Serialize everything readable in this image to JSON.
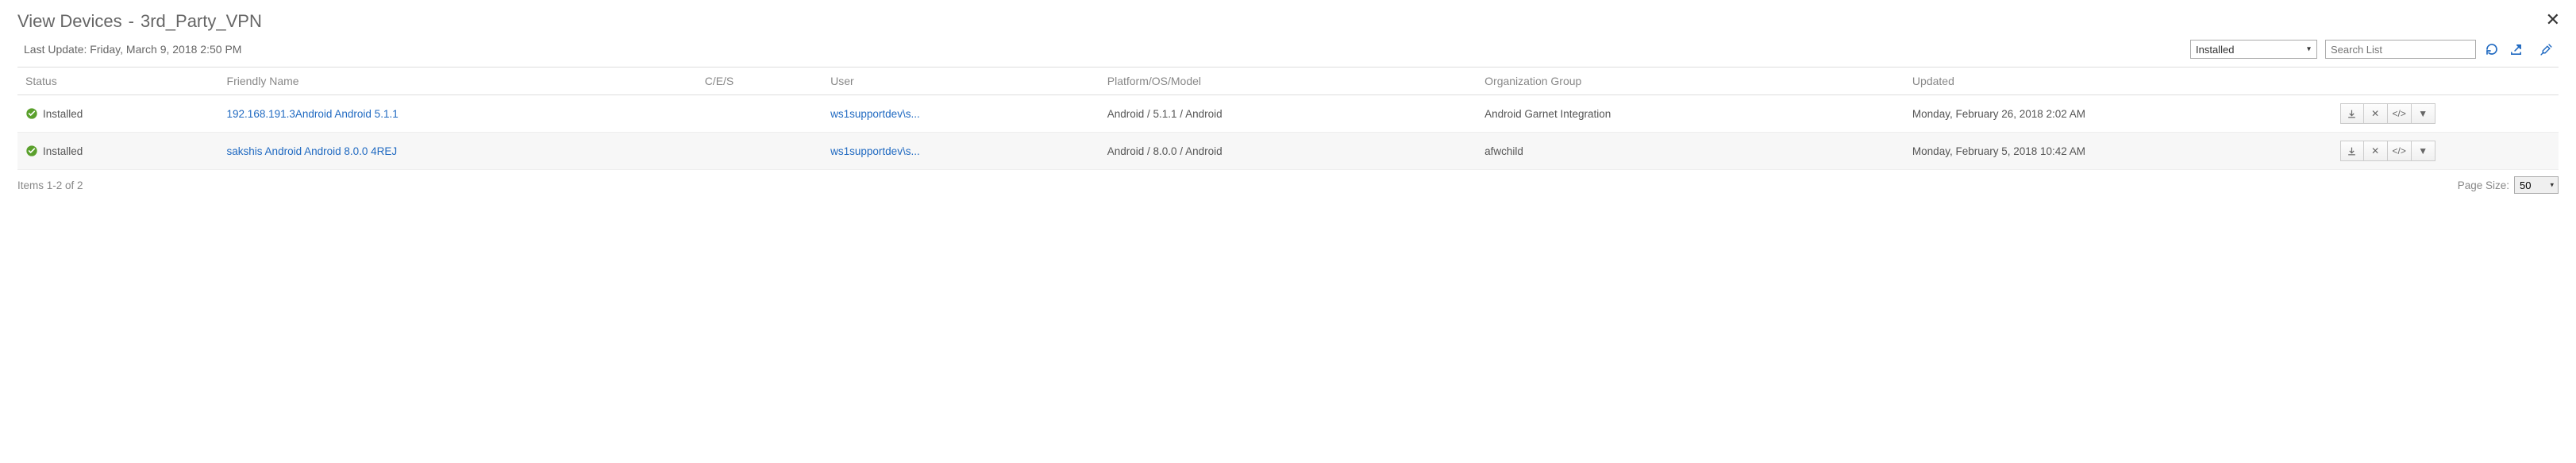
{
  "header": {
    "title_prefix": "View Devices",
    "dash": "  -  ",
    "title_name": "3rd_Party_VPN"
  },
  "last_update": {
    "label": "Last Update: ",
    "value": "Friday, March 9, 2018 2:50 PM"
  },
  "controls": {
    "status_selected": "Installed",
    "search_placeholder": "Search List"
  },
  "columns": {
    "status": "Status",
    "friendly_name": "Friendly Name",
    "ces": "C/E/S",
    "user": "User",
    "platform": "Platform/OS/Model",
    "org_group": "Organization Group",
    "updated": "Updated"
  },
  "rows": [
    {
      "status": "Installed",
      "friendly_name": "192.168.191.3Android Android 5.1.1",
      "ces": "",
      "user": "ws1supportdev\\s...",
      "platform": "Android / 5.1.1 / Android",
      "org_group": "Android Garnet Integration",
      "updated": "Monday, February 26, 2018 2:02 AM"
    },
    {
      "status": "Installed",
      "friendly_name": "sakshis Android Android 8.0.0 4REJ",
      "ces": "",
      "user": "ws1supportdev\\s...",
      "platform": "Android / 8.0.0 / Android",
      "org_group": "afwchild",
      "updated": "Monday, February 5, 2018 10:42 AM"
    }
  ],
  "footer": {
    "items_text": "Items 1-2 of 2",
    "page_size_label": "Page Size:",
    "page_size_value": "50"
  }
}
